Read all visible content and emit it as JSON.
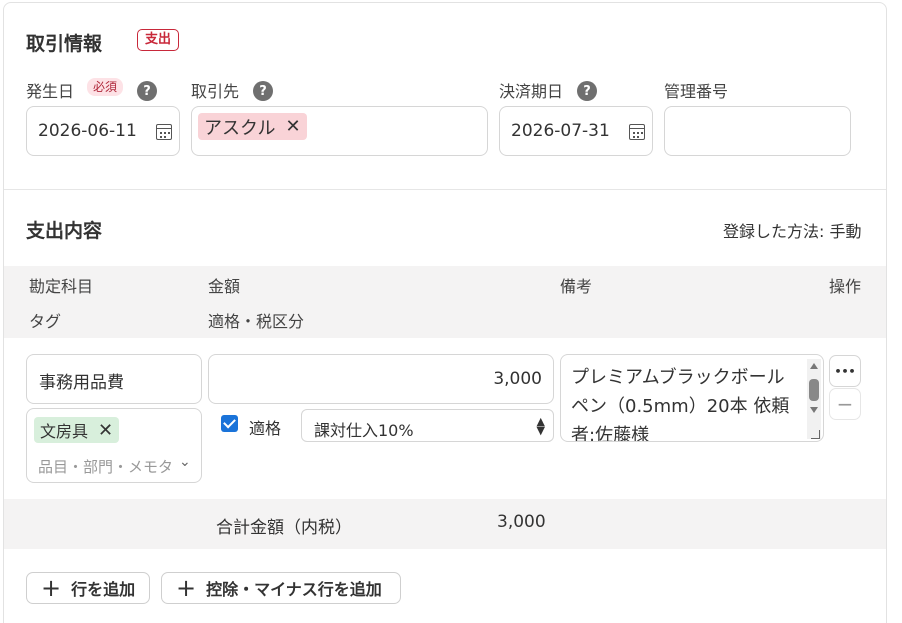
{
  "transaction": {
    "title": "取引情報",
    "type_badge": "支出"
  },
  "fields": {
    "issue_date": {
      "label": "発生日",
      "required_badge": "必須",
      "value": "2026-06-11"
    },
    "partner": {
      "label": "取引先",
      "chip": "アスクル"
    },
    "due_date": {
      "label": "決済期日",
      "value": "2026-07-31"
    },
    "management_no": {
      "label": "管理番号",
      "value": ""
    }
  },
  "icons": {
    "help": "help-circle-icon",
    "calendar": "calendar-icon",
    "remove": "close-icon"
  },
  "expense": {
    "title": "支出内容",
    "method": "登録した方法: 手動",
    "headers": {
      "account": "勘定科目",
      "amount": "金額",
      "remarks": "備考",
      "action": "操作",
      "tag": "タグ",
      "tax": "適格・税区分"
    },
    "row": {
      "account": "事務用品費",
      "amount": "3,000",
      "remarks": "プレミアムブラックボールペン（0.5mm）20本 依頼者:佐藤様",
      "tag_chip": "文房具",
      "tag_placeholder": "品目・部門・メモタグ",
      "qualified_label": "適格",
      "qualified_checked": true,
      "tax_category": "課対仕入10%",
      "more_label": "•••",
      "remove_label": "−"
    },
    "total": {
      "label": "合計金額（内税）",
      "value": "3,000"
    },
    "buttons": {
      "add_row": "行を追加",
      "add_deduction_row": "控除・マイナス行を追加"
    }
  },
  "colors": {
    "expense_badge": "#c8283a",
    "partner_chip": "#f9d3d7",
    "tag_chip": "#d8efdc",
    "checkbox": "#1a73d9"
  }
}
